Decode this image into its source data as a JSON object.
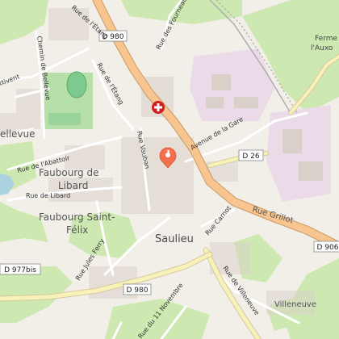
{
  "map": {
    "places": {
      "saulieu": "Saulieu",
      "faubourg_libard_1": "Faubourg de",
      "faubourg_libard_2": "Libard",
      "faubourg_saint_felix_1": "Faubourg Saint-",
      "faubourg_saint_felix_2": "Félix",
      "bellevue": "ellevue",
      "villeneuve": "Villeneuve",
      "ferme_1": "Ferme",
      "ferme_2": "l'Auxo"
    },
    "roads": {
      "d980_top": "D 980",
      "d980_bottom": "D 980",
      "d26": "D 26",
      "d906": "D 906",
      "d977bis": "D 977bis",
      "rue_grillot": "Rue Grillot",
      "rue_de_letang_1": "Rue de l'Étang",
      "rue_de_letang_2": "Rue de l'Étang",
      "rue_des_fourneaux": "Rue des Fourneaux",
      "chemin_de_bellevue": "Chemin de Bellevue",
      "rue_de_labattoir": "Rue de l'Abattoir",
      "rue_de_libard": "Rue de Libard",
      "rue_vauban": "Rue Vauban",
      "avenue_de_la_gare": "Avenue de la Gare",
      "rue_jules_ferry": "Rue Jules Ferry",
      "rue_carnot": "Rue Carnot",
      "rue_de_villeneuve": "Rue de Villeneuve",
      "rue_du_11_novembre": "Rue du 11 Novembre",
      "ttivent": "ttivent"
    },
    "markers": {
      "hospital": "hospital-icon",
      "location_pin": "map-pin-icon"
    },
    "colors": {
      "background": "#f2efe9",
      "green": "#cde8b0",
      "main_road": "#f8c48f",
      "secondary_road": "#f7f3b8",
      "building": "#d9d0c9",
      "pin": "#f36f4e",
      "hospital": "#d11c22"
    }
  }
}
